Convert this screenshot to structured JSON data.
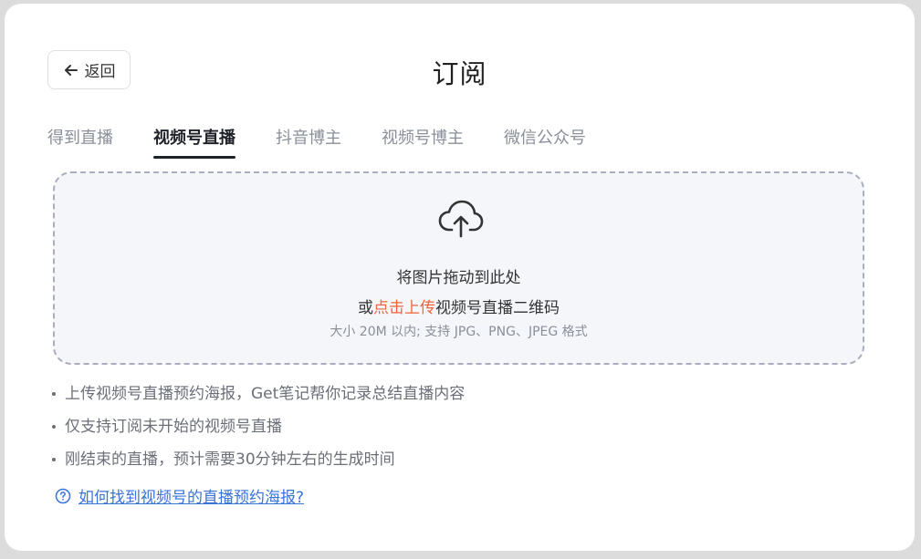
{
  "header": {
    "back_label": "返回",
    "title": "订阅"
  },
  "tabs": [
    {
      "label": "得到直播",
      "active": false
    },
    {
      "label": "视频号直播",
      "active": true
    },
    {
      "label": "抖音博主",
      "active": false
    },
    {
      "label": "视频号博主",
      "active": false
    },
    {
      "label": "微信公众号",
      "active": false
    }
  ],
  "upload": {
    "drag_text": "将图片拖动到此处",
    "prefix_text": "或",
    "link_text": "点击上传",
    "suffix_text": "视频号直播二维码",
    "hint": "大小 20M 以内; 支持 JPG、PNG、JPEG 格式"
  },
  "notes": [
    "上传视频号直播预约海报，Get笔记帮你记录总结直播内容",
    "仅支持订阅未开始的视频号直播",
    "刚结束的直播，预计需要30分钟左右的生成时间"
  ],
  "help_link": "如何找到视频号的直播预约海报?",
  "colors": {
    "accent_link": "#f0643c",
    "help_link": "#3b73d9",
    "active_tab": "#1f2329"
  }
}
